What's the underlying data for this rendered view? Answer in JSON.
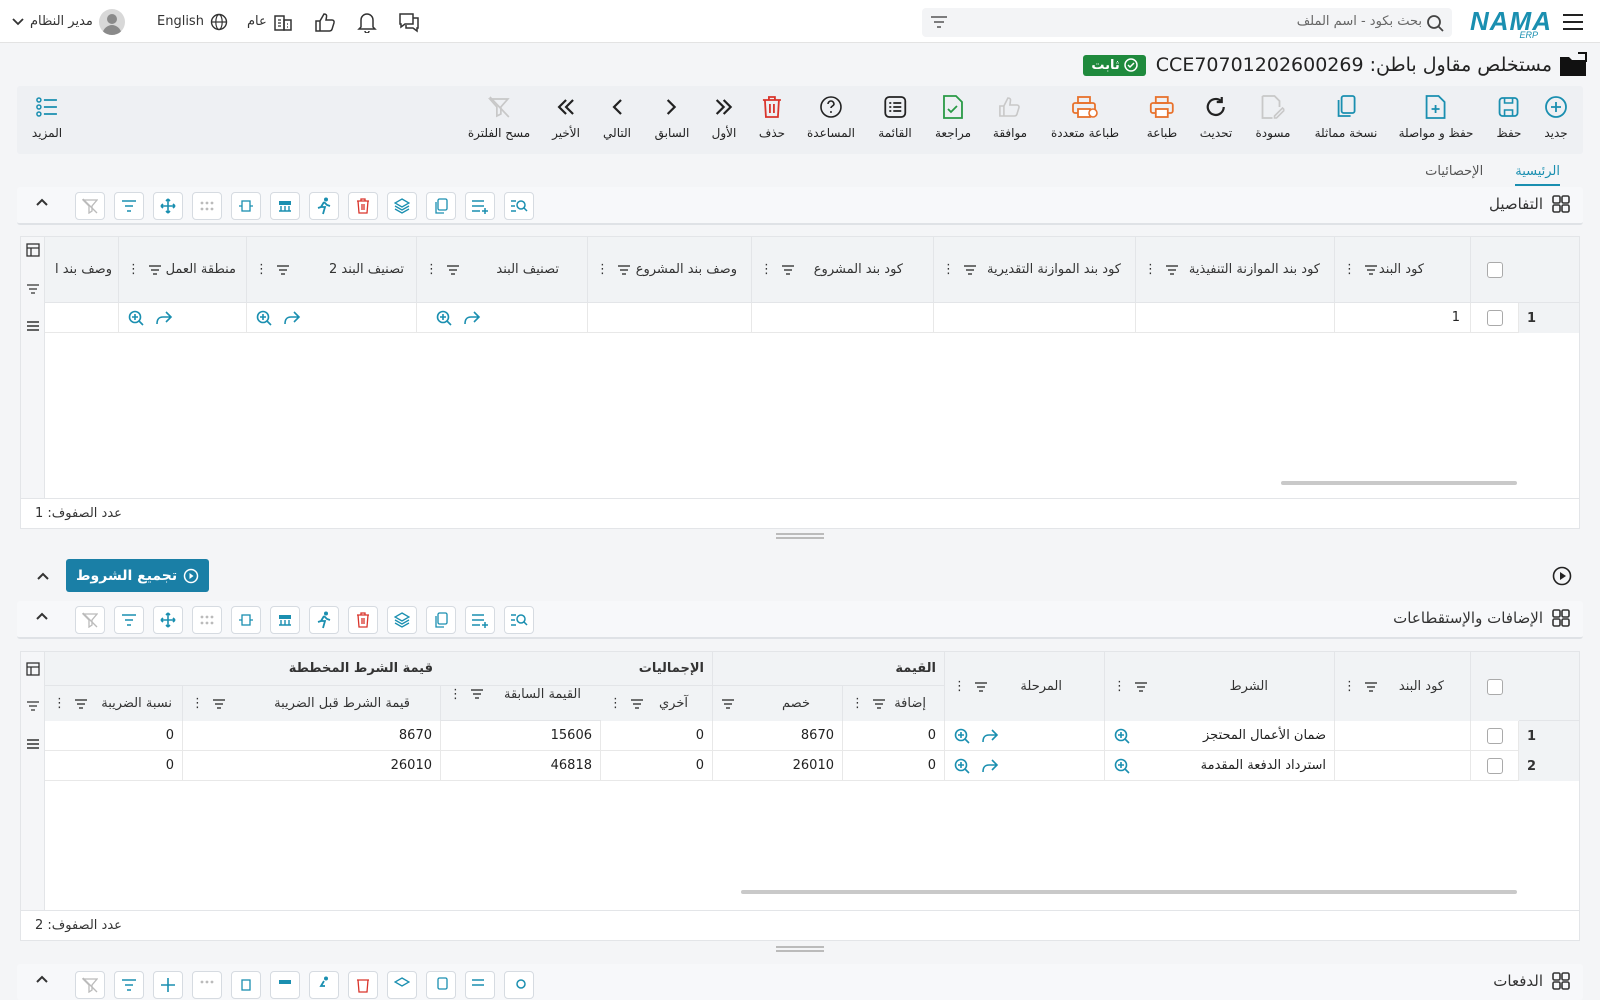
{
  "topbar": {
    "logo": "NAMA",
    "logo_sub": "ERP",
    "search_placeholder": "بحث بكود - اسم الملف",
    "user_name": "مدير النظام",
    "language": "English",
    "branch": "عام"
  },
  "page": {
    "title": "مستخلص مقاول باطن: CCE70701202600269",
    "status": "ثابت"
  },
  "toolbar": {
    "new": "جديد",
    "save": "حفظ",
    "save_continue": "حفظ و مواصلة",
    "duplicate": "نسخة مماثلة",
    "draft": "مسودة",
    "refresh": "تحديث",
    "print": "طباعة",
    "multi_print": "طباعة متعددة",
    "approve": "موافقة",
    "review": "مراجعة",
    "list": "القائمة",
    "help": "المساعدة",
    "delete": "حذف",
    "first": "الأول",
    "previous": "السابق",
    "next": "التالي",
    "last": "الأخير",
    "clear_filter": "مسح الفلترة",
    "more": "المزيد"
  },
  "tabs": [
    {
      "label": "الرئيسية",
      "active": true
    },
    {
      "label": "الإحصائيات",
      "active": false
    }
  ],
  "details": {
    "title": "التفاصيل",
    "columns": [
      "كود البند",
      "كود بند الموازنة التنفيذية",
      "كود بند الموازنة التقديرية",
      "كود بند المشروع",
      "وصف بند المشروع",
      "تصنيف البند",
      "تصنيف البند 2",
      "منطقة العمل",
      "وصف بند ا"
    ],
    "rows": [
      {
        "num": "1",
        "item_code": "1"
      }
    ],
    "footer": "عدد الصفوف: 1"
  },
  "aggregate_button": "تجميع الشروط",
  "additions": {
    "title": "الإضافات والإستقطاعات",
    "columns": {
      "item_code": "كود البند",
      "condition": "الشرط",
      "stage": "المرحلة",
      "value_group": "القيمة",
      "addition": "إضافة",
      "discount": "خصم",
      "totals_group": "الإجماليات",
      "other": "آخري",
      "previous_value": "القيمة السابقة",
      "planned_group": "قيمة الشرط المخططة",
      "value_before_tax": "قيمة الشرط قبل الضريبة",
      "tax_rate": "نسبة الضريبة"
    },
    "rows": [
      {
        "num": "1",
        "condition": "ضمان الأعمال المحتجز",
        "addition": "0",
        "discount": "8670",
        "other": "0",
        "previous": "15606",
        "before_tax": "8670",
        "tax": "0"
      },
      {
        "num": "2",
        "condition": "استرداد الدفعة المقدمة",
        "addition": "0",
        "discount": "26010",
        "other": "0",
        "previous": "46818",
        "before_tax": "26010",
        "tax": "0"
      }
    ],
    "footer": "عدد الصفوف: 2"
  },
  "payments": {
    "title": "الدفعات"
  },
  "colors": {
    "accent": "#1a8fb0",
    "status_green": "#1f8a3d",
    "danger": "#d9342b",
    "orange": "#e8722c",
    "approve_disabled": "#c8c8c8"
  }
}
